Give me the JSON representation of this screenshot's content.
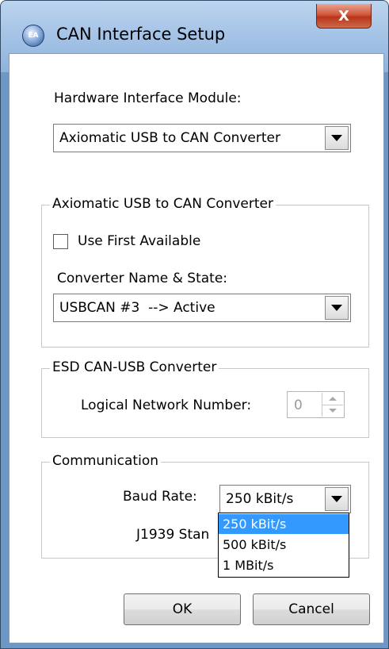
{
  "window": {
    "title": "CAN Interface Setup",
    "icon_text": "EA",
    "close_glyph": "X"
  },
  "hardware": {
    "label": "Hardware Interface Module:",
    "selected": "Axiomatic USB to CAN Converter"
  },
  "axiomatic_group": {
    "legend": "Axiomatic USB to CAN Converter",
    "use_first_available": {
      "label": "Use First Available",
      "checked": false
    },
    "converter_label": "Converter Name & State:",
    "converter_selected": "USBCAN #3  --> Active"
  },
  "esd_group": {
    "legend": "ESD CAN-USB Converter",
    "network_label": "Logical Network Number:",
    "network_value": "0"
  },
  "communication_group": {
    "legend": "Communication",
    "baud_label": "Baud Rate:",
    "baud_selected": "250 kBit/s",
    "standard_label_partial": "J1939 Stan",
    "baud_options": [
      "250 kBit/s",
      "500 kBit/s",
      "1 MBit/s"
    ],
    "highlighted_option": 0
  },
  "buttons": {
    "ok": "OK",
    "cancel": "Cancel"
  }
}
